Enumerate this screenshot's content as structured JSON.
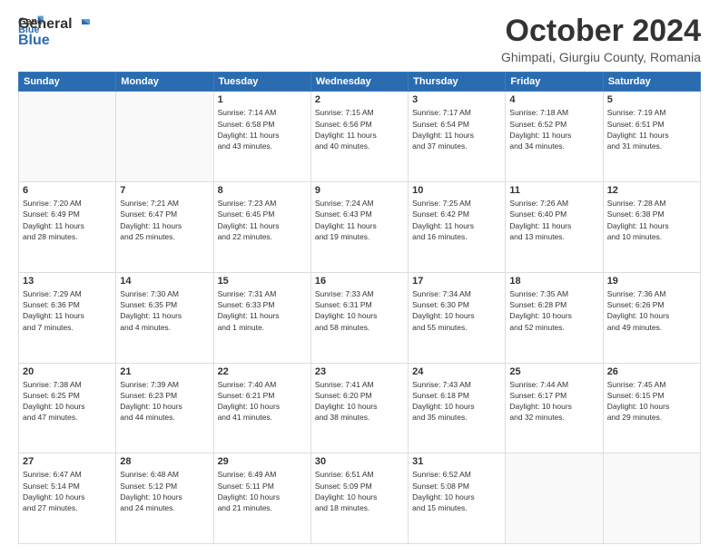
{
  "logo": {
    "general": "General",
    "blue": "Blue"
  },
  "title": {
    "month": "October 2024",
    "location": "Ghimpati, Giurgiu County, Romania"
  },
  "weekdays": [
    "Sunday",
    "Monday",
    "Tuesday",
    "Wednesday",
    "Thursday",
    "Friday",
    "Saturday"
  ],
  "weeks": [
    [
      {
        "day": "",
        "info": ""
      },
      {
        "day": "",
        "info": ""
      },
      {
        "day": "1",
        "info": "Sunrise: 7:14 AM\nSunset: 6:58 PM\nDaylight: 11 hours\nand 43 minutes."
      },
      {
        "day": "2",
        "info": "Sunrise: 7:15 AM\nSunset: 6:56 PM\nDaylight: 11 hours\nand 40 minutes."
      },
      {
        "day": "3",
        "info": "Sunrise: 7:17 AM\nSunset: 6:54 PM\nDaylight: 11 hours\nand 37 minutes."
      },
      {
        "day": "4",
        "info": "Sunrise: 7:18 AM\nSunset: 6:52 PM\nDaylight: 11 hours\nand 34 minutes."
      },
      {
        "day": "5",
        "info": "Sunrise: 7:19 AM\nSunset: 6:51 PM\nDaylight: 11 hours\nand 31 minutes."
      }
    ],
    [
      {
        "day": "6",
        "info": "Sunrise: 7:20 AM\nSunset: 6:49 PM\nDaylight: 11 hours\nand 28 minutes."
      },
      {
        "day": "7",
        "info": "Sunrise: 7:21 AM\nSunset: 6:47 PM\nDaylight: 11 hours\nand 25 minutes."
      },
      {
        "day": "8",
        "info": "Sunrise: 7:23 AM\nSunset: 6:45 PM\nDaylight: 11 hours\nand 22 minutes."
      },
      {
        "day": "9",
        "info": "Sunrise: 7:24 AM\nSunset: 6:43 PM\nDaylight: 11 hours\nand 19 minutes."
      },
      {
        "day": "10",
        "info": "Sunrise: 7:25 AM\nSunset: 6:42 PM\nDaylight: 11 hours\nand 16 minutes."
      },
      {
        "day": "11",
        "info": "Sunrise: 7:26 AM\nSunset: 6:40 PM\nDaylight: 11 hours\nand 13 minutes."
      },
      {
        "day": "12",
        "info": "Sunrise: 7:28 AM\nSunset: 6:38 PM\nDaylight: 11 hours\nand 10 minutes."
      }
    ],
    [
      {
        "day": "13",
        "info": "Sunrise: 7:29 AM\nSunset: 6:36 PM\nDaylight: 11 hours\nand 7 minutes."
      },
      {
        "day": "14",
        "info": "Sunrise: 7:30 AM\nSunset: 6:35 PM\nDaylight: 11 hours\nand 4 minutes."
      },
      {
        "day": "15",
        "info": "Sunrise: 7:31 AM\nSunset: 6:33 PM\nDaylight: 11 hours\nand 1 minute."
      },
      {
        "day": "16",
        "info": "Sunrise: 7:33 AM\nSunset: 6:31 PM\nDaylight: 10 hours\nand 58 minutes."
      },
      {
        "day": "17",
        "info": "Sunrise: 7:34 AM\nSunset: 6:30 PM\nDaylight: 10 hours\nand 55 minutes."
      },
      {
        "day": "18",
        "info": "Sunrise: 7:35 AM\nSunset: 6:28 PM\nDaylight: 10 hours\nand 52 minutes."
      },
      {
        "day": "19",
        "info": "Sunrise: 7:36 AM\nSunset: 6:26 PM\nDaylight: 10 hours\nand 49 minutes."
      }
    ],
    [
      {
        "day": "20",
        "info": "Sunrise: 7:38 AM\nSunset: 6:25 PM\nDaylight: 10 hours\nand 47 minutes."
      },
      {
        "day": "21",
        "info": "Sunrise: 7:39 AM\nSunset: 6:23 PM\nDaylight: 10 hours\nand 44 minutes."
      },
      {
        "day": "22",
        "info": "Sunrise: 7:40 AM\nSunset: 6:21 PM\nDaylight: 10 hours\nand 41 minutes."
      },
      {
        "day": "23",
        "info": "Sunrise: 7:41 AM\nSunset: 6:20 PM\nDaylight: 10 hours\nand 38 minutes."
      },
      {
        "day": "24",
        "info": "Sunrise: 7:43 AM\nSunset: 6:18 PM\nDaylight: 10 hours\nand 35 minutes."
      },
      {
        "day": "25",
        "info": "Sunrise: 7:44 AM\nSunset: 6:17 PM\nDaylight: 10 hours\nand 32 minutes."
      },
      {
        "day": "26",
        "info": "Sunrise: 7:45 AM\nSunset: 6:15 PM\nDaylight: 10 hours\nand 29 minutes."
      }
    ],
    [
      {
        "day": "27",
        "info": "Sunrise: 6:47 AM\nSunset: 5:14 PM\nDaylight: 10 hours\nand 27 minutes."
      },
      {
        "day": "28",
        "info": "Sunrise: 6:48 AM\nSunset: 5:12 PM\nDaylight: 10 hours\nand 24 minutes."
      },
      {
        "day": "29",
        "info": "Sunrise: 6:49 AM\nSunset: 5:11 PM\nDaylight: 10 hours\nand 21 minutes."
      },
      {
        "day": "30",
        "info": "Sunrise: 6:51 AM\nSunset: 5:09 PM\nDaylight: 10 hours\nand 18 minutes."
      },
      {
        "day": "31",
        "info": "Sunrise: 6:52 AM\nSunset: 5:08 PM\nDaylight: 10 hours\nand 15 minutes."
      },
      {
        "day": "",
        "info": ""
      },
      {
        "day": "",
        "info": ""
      }
    ]
  ]
}
